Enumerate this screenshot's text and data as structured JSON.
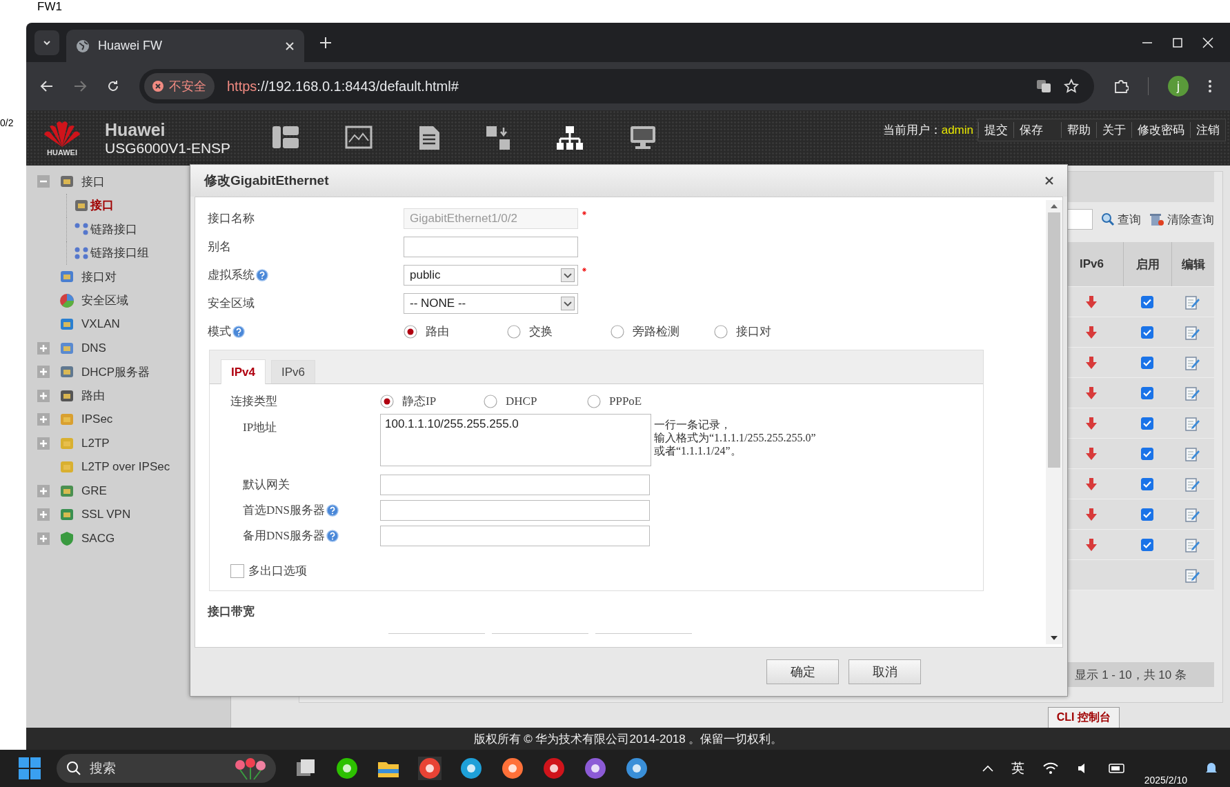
{
  "desktop": {
    "labels": [
      "FW1",
      "0/2"
    ]
  },
  "browser": {
    "tab_title": "Huawei FW",
    "security_label": "不安全",
    "url_scheme": "https",
    "url_rest": "://192.168.0.1:8443/default.html#",
    "profile_initial": "j"
  },
  "header": {
    "brand": "Huawei",
    "logo_text": "HUAWEI",
    "model": "USG6000V1-ENSP",
    "user_label": "当前用户：",
    "user": "admin",
    "links": [
      "提交",
      "保存",
      "帮助",
      "关于",
      "修改密码",
      "注销"
    ]
  },
  "sidebar": {
    "items": [
      {
        "label": "接口",
        "kind": "port",
        "expandable": true,
        "expanded": true,
        "selected": false,
        "children": [
          {
            "label": "接口",
            "kind": "port",
            "selected": true
          },
          {
            "label": "链路接口",
            "kind": "link",
            "selected": false
          },
          {
            "label": "链路接口组",
            "kind": "linkgroup",
            "selected": false
          }
        ]
      },
      {
        "label": "接口对",
        "kind": "pair",
        "expandable": false,
        "selected": false
      },
      {
        "label": "安全区域",
        "kind": "zone",
        "expandable": false,
        "selected": false
      },
      {
        "label": "VXLAN",
        "kind": "vxlan",
        "expandable": false,
        "selected": false
      },
      {
        "label": "DNS",
        "kind": "dns",
        "expandable": true,
        "expanded": false,
        "selected": false
      },
      {
        "label": "DHCP服务器",
        "kind": "dhcp",
        "expandable": true,
        "expanded": false,
        "selected": false
      },
      {
        "label": "路由",
        "kind": "route",
        "expandable": true,
        "expanded": false,
        "selected": false
      },
      {
        "label": "IPSec",
        "kind": "ipsec",
        "expandable": true,
        "expanded": false,
        "selected": false
      },
      {
        "label": "L2TP",
        "kind": "l2tp",
        "expandable": true,
        "expanded": false,
        "selected": false
      },
      {
        "label": "L2TP over IPSec",
        "kind": "l2tp",
        "expandable": false,
        "selected": false
      },
      {
        "label": "GRE",
        "kind": "gre",
        "expandable": true,
        "expanded": false,
        "selected": false
      },
      {
        "label": "SSL VPN",
        "kind": "sslvpn",
        "expandable": true,
        "expanded": false,
        "selected": false
      },
      {
        "label": "SACG",
        "kind": "sacg",
        "expandable": true,
        "expanded": false,
        "selected": false
      }
    ]
  },
  "table": {
    "search_label": "查询",
    "clear_label": "清除查询",
    "columns": [
      "IPv6",
      "启用",
      "编辑"
    ],
    "rows": [
      {
        "kind": "entry",
        "enabled": true
      },
      {
        "kind": "entry",
        "enabled": true
      },
      {
        "kind": "entry",
        "enabled": true
      },
      {
        "kind": "entry",
        "enabled": true
      },
      {
        "kind": "entry",
        "enabled": true
      },
      {
        "kind": "entry",
        "enabled": true
      },
      {
        "kind": "entry",
        "enabled": true
      },
      {
        "kind": "entry",
        "enabled": true
      },
      {
        "kind": "entry",
        "enabled": true
      },
      {
        "kind": "blank"
      }
    ],
    "pager": "显示 1 - 10，共 10 条"
  },
  "cli_button": "CLI 控制台",
  "dialog": {
    "title": "修改GigabitEthernet",
    "fields": [
      {
        "kind": "text",
        "label": "接口名称",
        "value": "GigabitEthernet1/0/2",
        "disabled": true,
        "required": true,
        "help": false
      },
      {
        "kind": "text",
        "label": "别名",
        "disabled": false,
        "required": false,
        "help": false
      },
      {
        "kind": "select",
        "label": "虚拟系统",
        "value": "public",
        "required": true,
        "help": true
      },
      {
        "kind": "select",
        "label": "安全区域",
        "value": "-- NONE --",
        "required": false,
        "help": false
      },
      {
        "kind": "radio",
        "label": "模式",
        "help": true,
        "required": false,
        "options": [
          {
            "label": "路由",
            "selected": true
          },
          {
            "label": "交换",
            "selected": false
          },
          {
            "label": "旁路检测",
            "selected": false
          },
          {
            "label": "接口对",
            "selected": false
          }
        ]
      }
    ],
    "tabs": [
      {
        "label": "IPv4",
        "selected": true
      },
      {
        "label": "IPv6",
        "selected": false
      }
    ],
    "ipv4": {
      "conn_label": "连接类型",
      "conn_options": [
        {
          "label": "静态IP",
          "selected": true
        },
        {
          "label": "DHCP",
          "selected": false
        },
        {
          "label": "PPPoE",
          "selected": false
        }
      ],
      "ip_label": "IP地址",
      "ip_value": "100.1.1.10/255.255.255.0",
      "ip_hint": [
        "一行一条记录，",
        "输入格式为“1.1.1.1/255.255.255.0”",
        "或者“1.1.1.1/24”。"
      ],
      "inputs": [
        {
          "label": "默认网关",
          "help": false
        },
        {
          "label": "首选DNS服务器",
          "help": true
        },
        {
          "label": "备用DNS服务器",
          "help": true
        }
      ],
      "multi_exit": {
        "label": "多出口选项",
        "checked": false
      }
    },
    "section_title": "接口带宽",
    "buttons": [
      "确定",
      "取消"
    ]
  },
  "footer": "版权所有 © 华为技术有限公司2014-2018 。保留一切权利。",
  "taskbar": {
    "search_placeholder": "搜索",
    "ime": "英",
    "date": "2025/2/10"
  }
}
